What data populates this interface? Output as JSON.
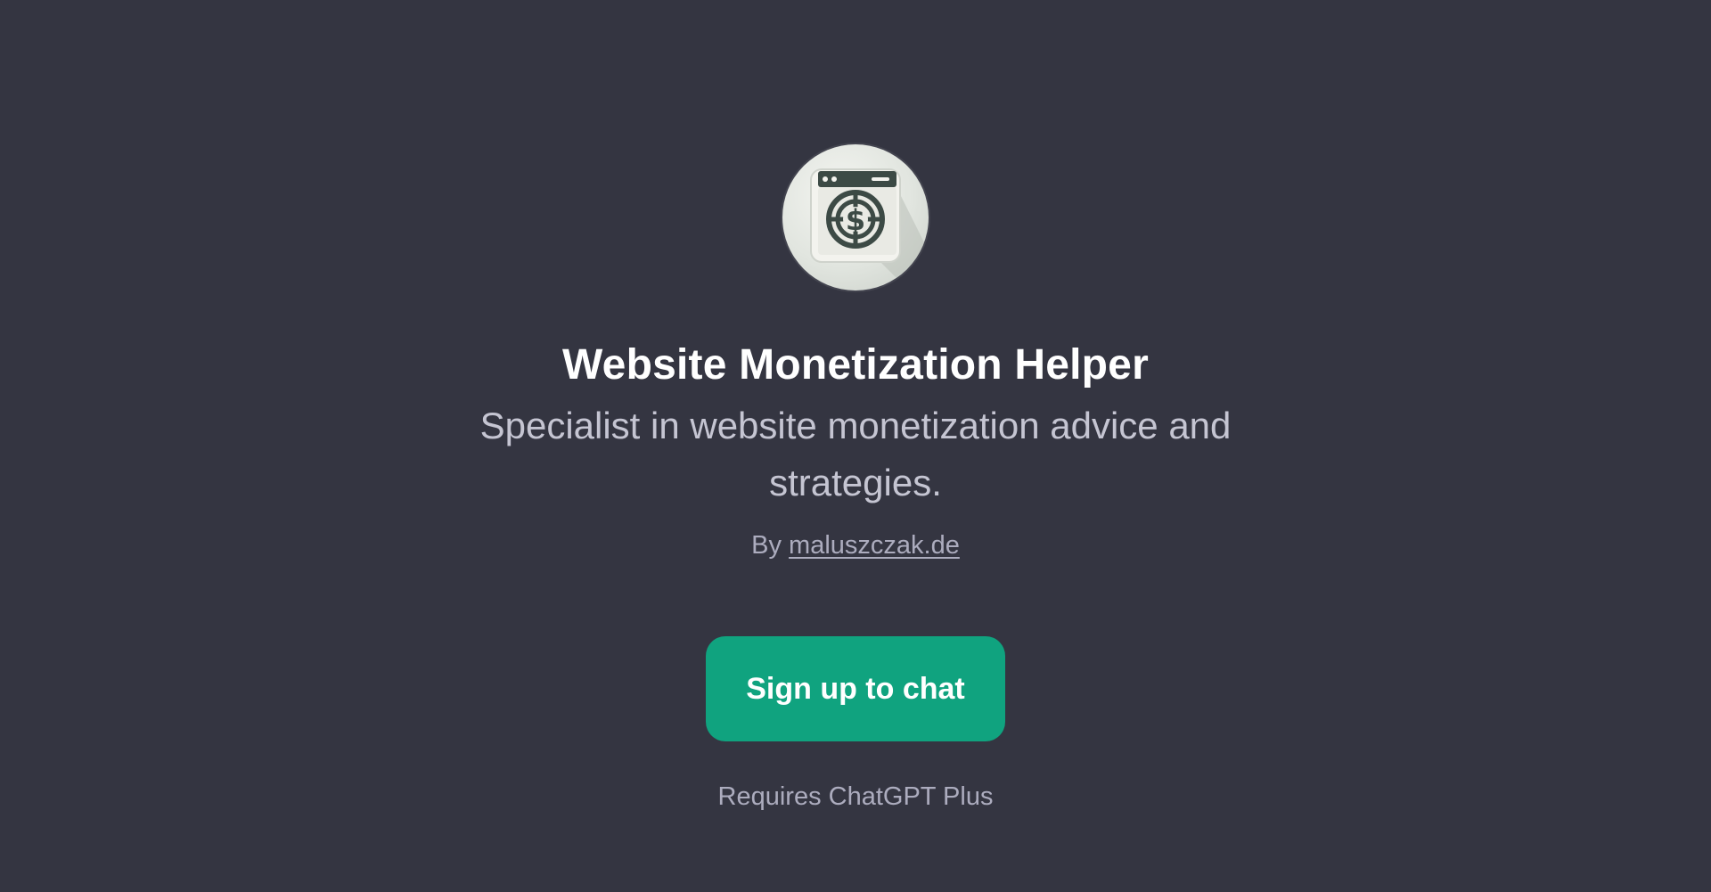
{
  "gpt": {
    "icon": "website-monetization-dollar-icon",
    "name": "Website Monetization Helper",
    "description": "Specialist in website monetization advice and strategies.",
    "by_prefix": "By",
    "author": "maluszczak.de"
  },
  "cta": {
    "label": "Sign up to chat"
  },
  "note": "Requires ChatGPT Plus",
  "colors": {
    "background": "#343541",
    "accent": "#10a37f",
    "title": "#ffffff",
    "subtitle": "#c5c5d2",
    "muted": "#acacbe"
  }
}
